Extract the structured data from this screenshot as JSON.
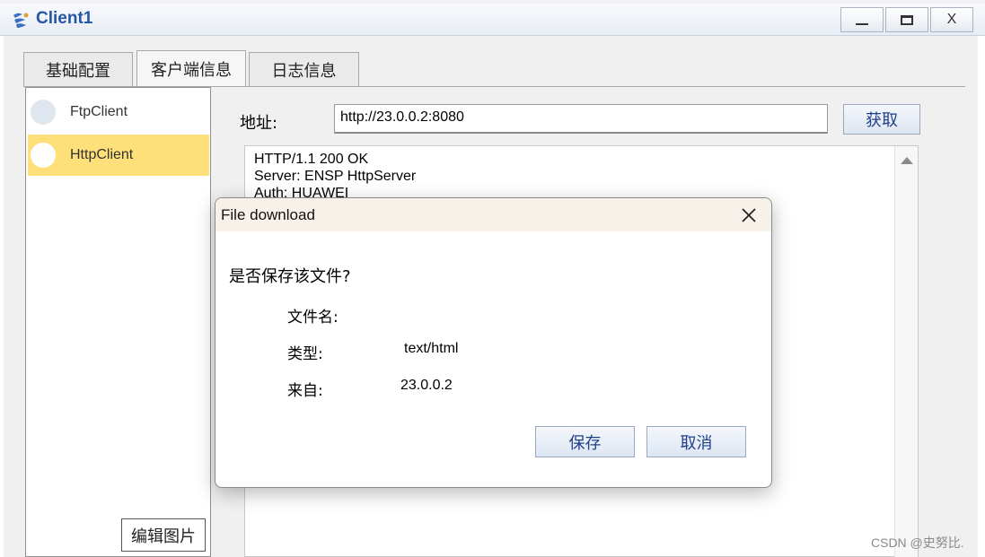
{
  "window": {
    "title": "Client1",
    "controls": {
      "minimize": "_",
      "maximize": "□",
      "close": "X"
    }
  },
  "tabs": [
    {
      "label": "基础配置",
      "active": false
    },
    {
      "label": "客户端信息",
      "active": true
    },
    {
      "label": "日志信息",
      "active": false
    }
  ],
  "sidebar": {
    "items": [
      {
        "label": "FtpClient",
        "selected": false
      },
      {
        "label": "HttpClient",
        "selected": true
      }
    ],
    "selected_color": "#fde07a"
  },
  "address": {
    "label": "地址:",
    "value": "http://23.0.0.2:8080",
    "fetch_label": "获取"
  },
  "response": {
    "lines": [
      "HTTP/1.1 200 OK",
      "Server: ENSP HttpServer",
      "Auth: HUAWEI"
    ]
  },
  "dialog": {
    "title": "File download",
    "question": "是否保存该文件?",
    "filename_label": "文件名:",
    "filename_value": "",
    "type_label": "类型:",
    "type_value": "text/html",
    "from_label": "来自:",
    "from_value": "23.0.0.2",
    "save_label": "保存",
    "cancel_label": "取消"
  },
  "overlay": {
    "edit_image_label": "编辑图片",
    "watermark": "CSDN @史努比."
  },
  "colors": {
    "title_text": "#2457a6",
    "button_text": "#1f3f8a",
    "dialog_header": "#f7f1ea"
  }
}
